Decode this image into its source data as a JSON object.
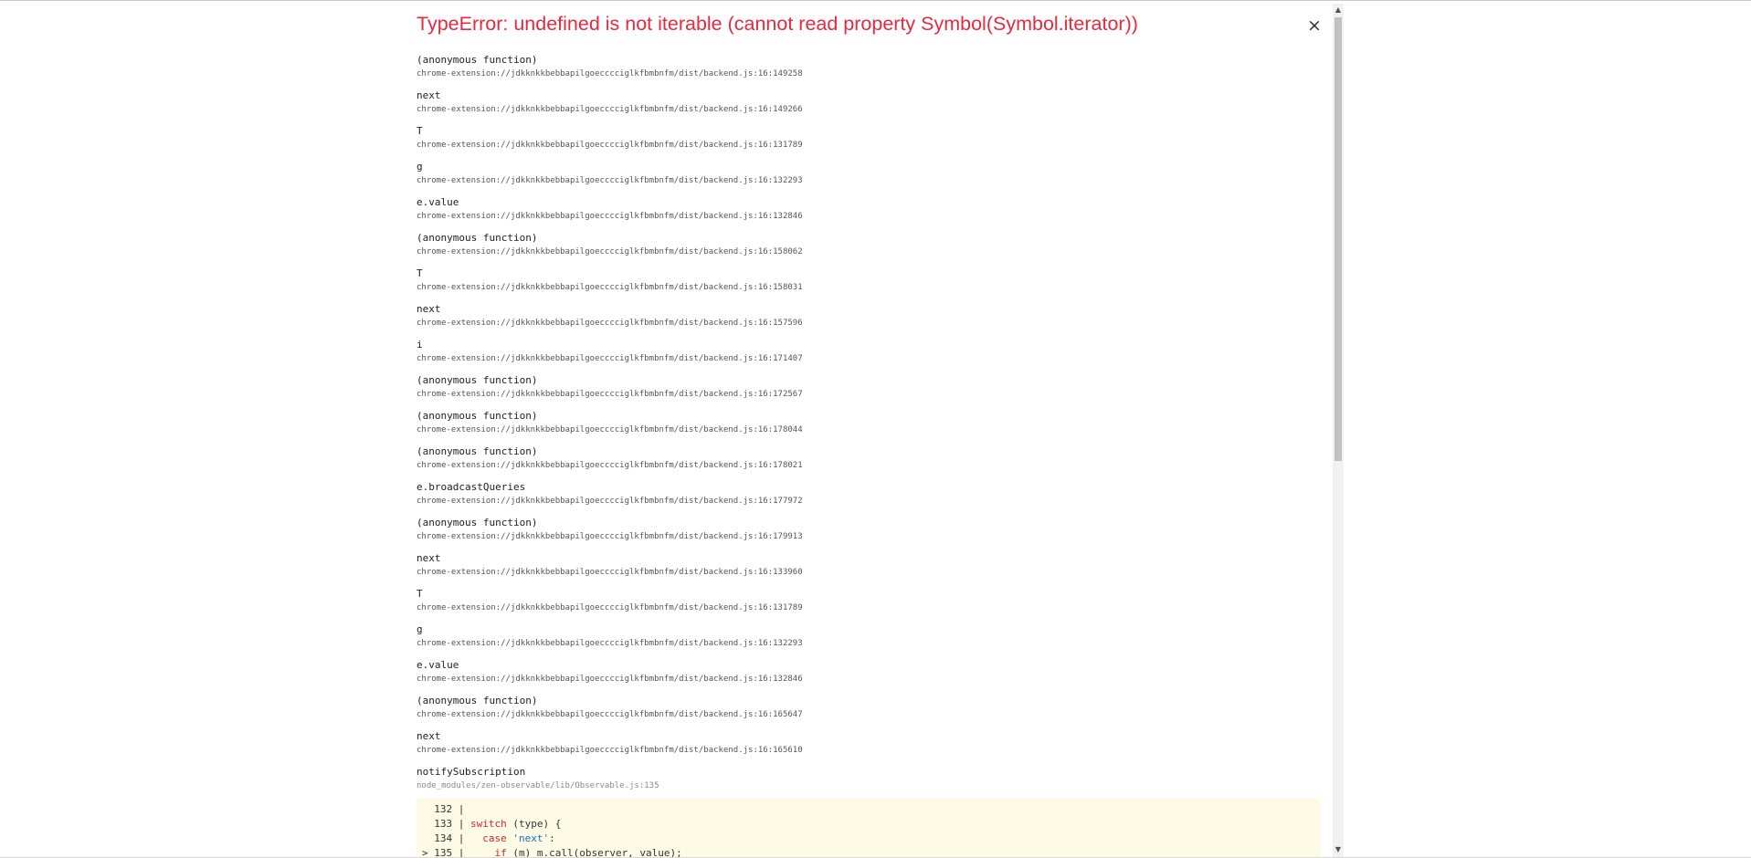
{
  "error": {
    "title": "TypeError: undefined is not iterable (cannot read property Symbol(Symbol.iterator))",
    "close_label": "×"
  },
  "colors": {
    "error_title": "#e8283f",
    "code_background": "#fdfbe6",
    "keyword": "#d6262c",
    "string": "#1b6fb5"
  },
  "stack": [
    {
      "fn": "(anonymous function)",
      "loc": "chrome-extension://jdkknkkbebbapilgoecccciglkfbmbnfm/dist/backend.js:16:149258"
    },
    {
      "fn": "next",
      "loc": "chrome-extension://jdkknkkbebbapilgoecccciglkfbmbnfm/dist/backend.js:16:149266"
    },
    {
      "fn": "T",
      "loc": "chrome-extension://jdkknkkbebbapilgoecccciglkfbmbnfm/dist/backend.js:16:131789"
    },
    {
      "fn": "g",
      "loc": "chrome-extension://jdkknkkbebbapilgoecccciglkfbmbnfm/dist/backend.js:16:132293"
    },
    {
      "fn": "e.value",
      "loc": "chrome-extension://jdkknkkbebbapilgoecccciglkfbmbnfm/dist/backend.js:16:132846"
    },
    {
      "fn": "(anonymous function)",
      "loc": "chrome-extension://jdkknkkbebbapilgoecccciglkfbmbnfm/dist/backend.js:16:158062"
    },
    {
      "fn": "T",
      "loc": "chrome-extension://jdkknkkbebbapilgoecccciglkfbmbnfm/dist/backend.js:16:158031"
    },
    {
      "fn": "next",
      "loc": "chrome-extension://jdkknkkbebbapilgoecccciglkfbmbnfm/dist/backend.js:16:157596"
    },
    {
      "fn": "i",
      "loc": "chrome-extension://jdkknkkbebbapilgoecccciglkfbmbnfm/dist/backend.js:16:171407"
    },
    {
      "fn": "(anonymous function)",
      "loc": "chrome-extension://jdkknkkbebbapilgoecccciglkfbmbnfm/dist/backend.js:16:172567"
    },
    {
      "fn": "(anonymous function)",
      "loc": "chrome-extension://jdkknkkbebbapilgoecccciglkfbmbnfm/dist/backend.js:16:178044"
    },
    {
      "fn": "(anonymous function)",
      "loc": "chrome-extension://jdkknkkbebbapilgoecccciglkfbmbnfm/dist/backend.js:16:178021"
    },
    {
      "fn": "e.broadcastQueries",
      "loc": "chrome-extension://jdkknkkbebbapilgoecccciglkfbmbnfm/dist/backend.js:16:177972"
    },
    {
      "fn": "(anonymous function)",
      "loc": "chrome-extension://jdkknkkbebbapilgoecccciglkfbmbnfm/dist/backend.js:16:179913"
    },
    {
      "fn": "next",
      "loc": "chrome-extension://jdkknkkbebbapilgoecccciglkfbmbnfm/dist/backend.js:16:133960"
    },
    {
      "fn": "T",
      "loc": "chrome-extension://jdkknkkbebbapilgoecccciglkfbmbnfm/dist/backend.js:16:131789"
    },
    {
      "fn": "g",
      "loc": "chrome-extension://jdkknkkbebbapilgoecccciglkfbmbnfm/dist/backend.js:16:132293"
    },
    {
      "fn": "e.value",
      "loc": "chrome-extension://jdkknkkbebbapilgoecccciglkfbmbnfm/dist/backend.js:16:132846"
    },
    {
      "fn": "(anonymous function)",
      "loc": "chrome-extension://jdkknkkbebbapilgoecccciglkfbmbnfm/dist/backend.js:16:165647"
    },
    {
      "fn": "next",
      "loc": "chrome-extension://jdkknkkbebbapilgoecccciglkfbmbnfm/dist/backend.js:16:165610"
    },
    {
      "fn": "notifySubscription",
      "loc": "node_modules/zen-observable/lib/Observable.js:135"
    }
  ],
  "code_snippet": [
    {
      "prefix": "  132 |",
      "keyword": "",
      "middle": "",
      "string": "",
      "rest": ""
    },
    {
      "prefix": "  133 | ",
      "keyword": "switch",
      "middle": " (type) {",
      "string": "",
      "rest": ""
    },
    {
      "prefix": "  134 |   ",
      "keyword": "case",
      "middle": " ",
      "string": "'next'",
      "rest": ":"
    },
    {
      "prefix": "> 135 |     ",
      "keyword": "if",
      "middle": " (m) m.call(observer, value);",
      "string": "",
      "rest": ""
    }
  ],
  "scrollbar": {
    "up_arrow": "▲",
    "down_arrow": "▼"
  }
}
